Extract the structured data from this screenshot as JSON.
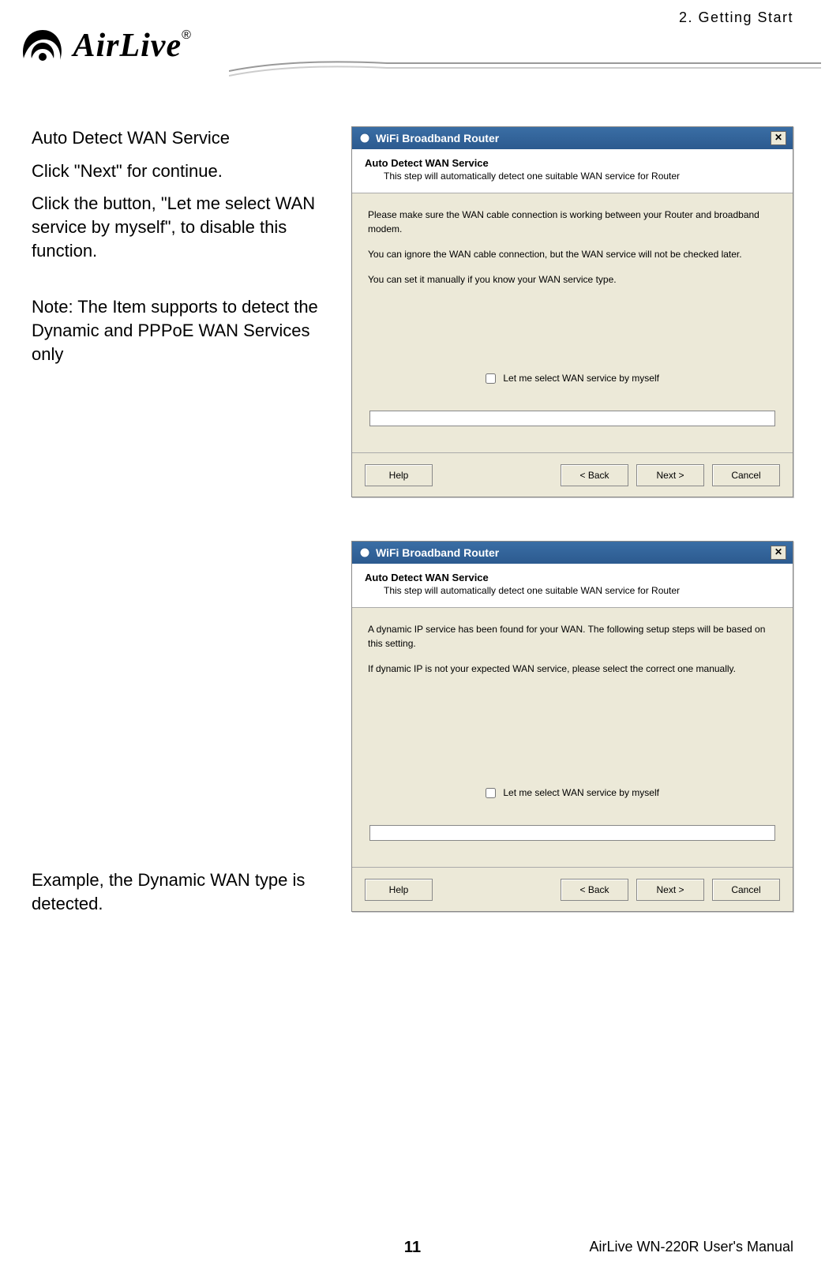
{
  "header": {
    "breadcrumb": "2.  Getting  Start"
  },
  "logo": {
    "brand": "AirLive",
    "registered": "®"
  },
  "left": {
    "h1": "Auto Detect WAN Service",
    "p1": "Click \"Next\" for continue.",
    "p2": "Click the button, \"Let me select WAN service by myself\", to disable this function.",
    "note": "Note: The Item supports to detect the Dynamic and PPPoE WAN Services only",
    "example": "Example, the Dynamic WAN type is detected."
  },
  "dialog1": {
    "title": "WiFi Broadband Router",
    "close": "✕",
    "hdr_title": "Auto Detect WAN Service",
    "hdr_sub": "This step will automatically detect one suitable WAN service for Router",
    "body_p1": "Please make sure the WAN cable connection is working between your Router and broadband modem.",
    "body_p2": "You can ignore the WAN cable connection, but the WAN service will not be checked later.",
    "body_p3": "You can set it manually if you know your WAN service type.",
    "checkbox_label": "Let me select WAN service by myself",
    "btn_help": "Help",
    "btn_back": "< Back",
    "btn_next": "Next >",
    "btn_cancel": "Cancel"
  },
  "dialog2": {
    "title": "WiFi Broadband Router",
    "close": "✕",
    "hdr_title": "Auto Detect WAN Service",
    "hdr_sub": "This step will automatically detect one suitable WAN service for Router",
    "body_p1": "A dynamic IP service has been found for your WAN. The following setup steps will be based on this setting.",
    "body_p2": "If dynamic IP is not your expected WAN service, please select the correct one manually.",
    "checkbox_label": "Let me select WAN service by myself",
    "btn_help": "Help",
    "btn_back": "< Back",
    "btn_next": "Next >",
    "btn_cancel": "Cancel"
  },
  "footer": {
    "page_number": "11",
    "manual": "AirLive  WN-220R  User's  Manual"
  }
}
